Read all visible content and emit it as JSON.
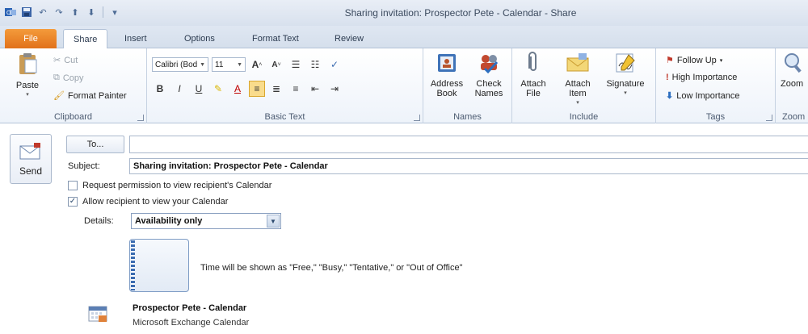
{
  "window": {
    "title": "Sharing invitation: Prospector Pete - Calendar - Share"
  },
  "quick_access": [
    "outlook-icon",
    "save-icon",
    "undo-icon",
    "redo-icon",
    "up-arrow-icon",
    "down-arrow-icon",
    "customize-icon"
  ],
  "tabs": [
    {
      "label": "File"
    },
    {
      "label": "Share"
    },
    {
      "label": "Insert"
    },
    {
      "label": "Options"
    },
    {
      "label": "Format Text"
    },
    {
      "label": "Review"
    }
  ],
  "ribbon": {
    "clipboard": {
      "label": "Clipboard",
      "paste": "Paste",
      "cut": "Cut",
      "copy": "Copy",
      "format_painter": "Format Painter"
    },
    "basic_text": {
      "label": "Basic Text",
      "font": "Calibri (Bod",
      "size": "11"
    },
    "names": {
      "label": "Names",
      "address_book": "Address Book",
      "check_names": "Check Names"
    },
    "include": {
      "label": "Include",
      "attach_file": "Attach File",
      "attach_item": "Attach Item",
      "signature": "Signature"
    },
    "tags": {
      "label": "Tags",
      "follow_up": "Follow Up",
      "high_importance": "High Importance",
      "low_importance": "Low Importance"
    },
    "zoom": {
      "label": "Zoom",
      "button": "Zoom"
    }
  },
  "message": {
    "send_label": "Send",
    "to_label": "To...",
    "to_value": "",
    "subject_label": "Subject:",
    "subject_value": "Sharing invitation: Prospector Pete - Calendar",
    "request_permission": {
      "label": "Request permission to view recipient's Calendar",
      "checked": false
    },
    "allow_view": {
      "label": "Allow recipient to view your Calendar",
      "checked": true
    },
    "details_label": "Details:",
    "details_value": "Availability only",
    "preview_text": "Time will be shown as \"Free,\" \"Busy,\" \"Tentative,\" or \"Out of Office\"",
    "calendar_name": "Prospector Pete - Calendar",
    "calendar_type": "Microsoft Exchange Calendar"
  }
}
